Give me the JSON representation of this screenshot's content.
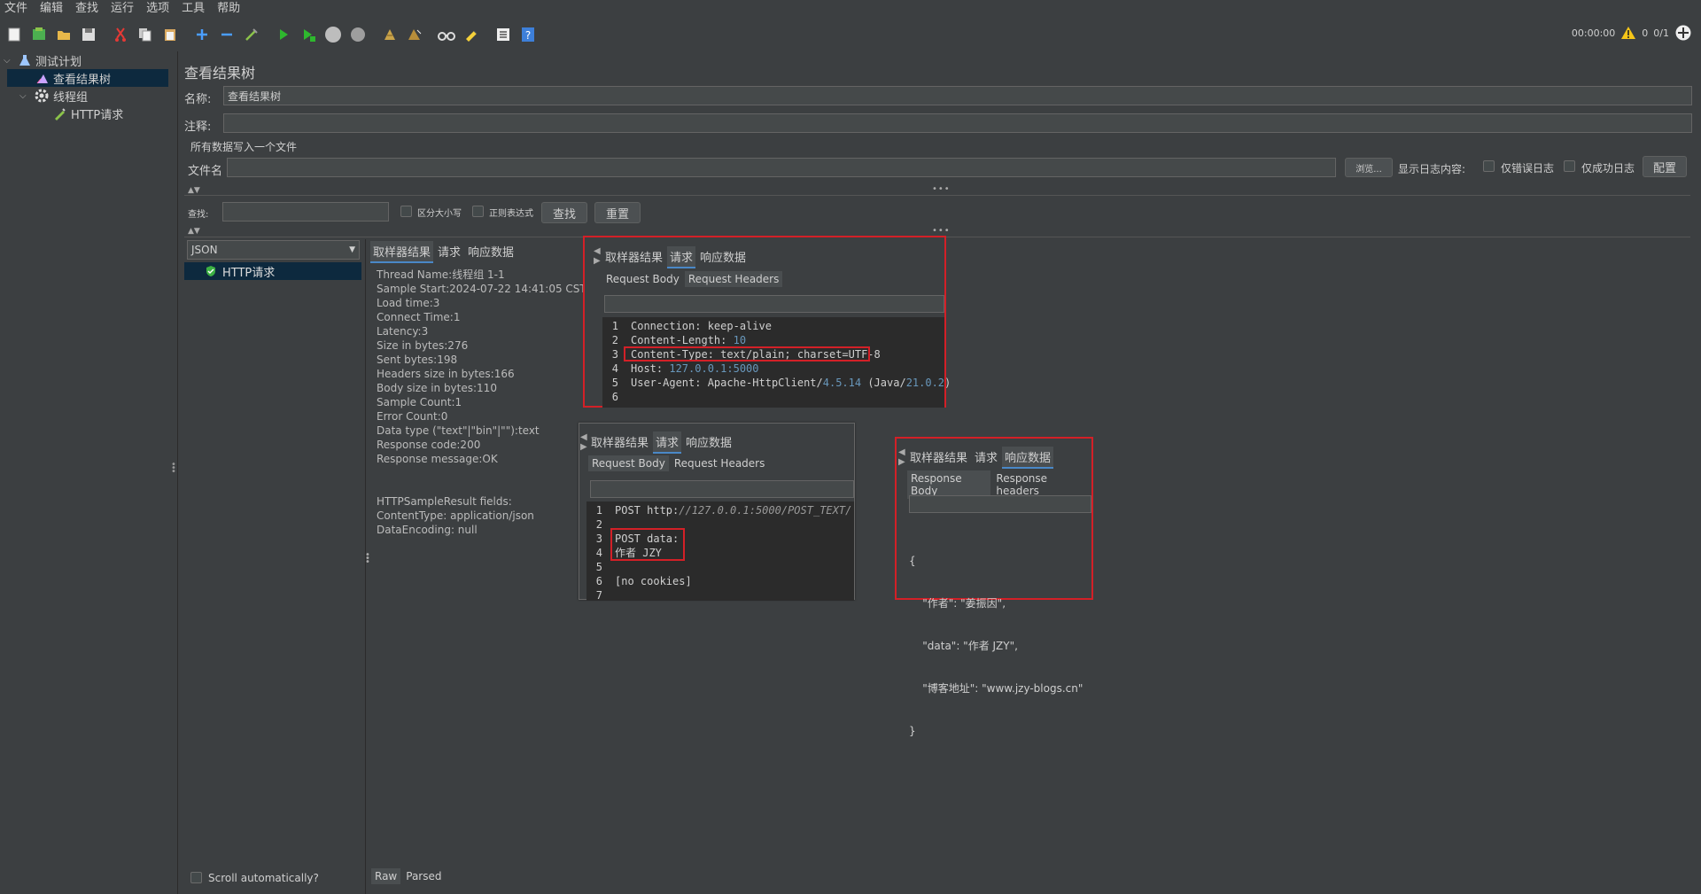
{
  "menu": [
    "文件",
    "编辑",
    "查找",
    "运行",
    "选项",
    "工具",
    "帮助"
  ],
  "toolbar": {
    "icons": [
      "new-icon",
      "templates-icon",
      "open-icon",
      "save-icon",
      "save-as-icon",
      "cut-icon",
      "copy-icon",
      "paste-icon",
      "expand-icon",
      "collapse-icon",
      "toggle-icon",
      "start-icon",
      "start-no-pause-icon",
      "stop-icon",
      "shutdown-icon",
      "clear-icon",
      "clear-all-icon",
      "search-icon",
      "reset-search-icon",
      "function-helper-icon",
      "help-icon"
    ],
    "timer": "00:00:00",
    "warnings": "0",
    "threads": "0/1"
  },
  "tree": {
    "items": [
      {
        "label": "测试计划",
        "icon": "test-plan-icon"
      },
      {
        "label": "查看结果树",
        "icon": "listener-icon"
      },
      {
        "label": "线程组",
        "icon": "gear-icon"
      },
      {
        "label": "HTTP请求",
        "icon": "sampler-icon"
      }
    ]
  },
  "main": {
    "title": "查看结果树",
    "name_label": "名称:",
    "name_value": "查看结果树",
    "comment_label": "注释:",
    "comment_value": "",
    "file_section": "所有数据写入一个文件",
    "filename_label": "文件名",
    "filename_value": "",
    "browse_button": "浏览...",
    "log_display_label": "显示日志内容:",
    "errors_only": "仅错误日志",
    "success_only": "仅成功日志",
    "config_button": "配置",
    "search_label": "查找:",
    "search_value": "",
    "case_sensitive": "区分大小写",
    "regex": "正则表达式",
    "find_button": "查找",
    "reset_button": "重置"
  },
  "results": {
    "renderer": "JSON",
    "list_items": [
      "HTTP请求"
    ],
    "scroll_auto": "Scroll automatically?",
    "tabs": [
      "取样器结果",
      "请求",
      "响应数据"
    ],
    "sampler_lines": [
      "Thread Name:线程组 1-1",
      "Sample Start:2024-07-22 14:41:05 CST",
      "Load time:3",
      "Connect Time:1",
      "Latency:3",
      "Size in bytes:276",
      "Sent bytes:198",
      "Headers size in bytes:166",
      "Body size in bytes:110",
      "Sample Count:1",
      "Error Count:0",
      "Data type (\"text\"|\"bin\"|\"\"):text",
      "Response code:200",
      "Response message:OK",
      "",
      "",
      "HTTPSampleResult fields:",
      "ContentType: application/json",
      "DataEncoding: null"
    ],
    "bottom_tabs": [
      "Raw",
      "Parsed"
    ]
  },
  "popup_headers": {
    "tabs": [
      "取样器结果",
      "请求",
      "响应数据"
    ],
    "subtabs": [
      "Request Body",
      "Request Headers"
    ],
    "lines": [
      {
        "n": "1",
        "text": "Connection: keep-alive"
      },
      {
        "n": "2",
        "pre": "Content-Length: ",
        "num": "10"
      },
      {
        "n": "3",
        "text": "Content-Type: text/plain; charset=UTF-8"
      },
      {
        "n": "4",
        "pre": "Host: ",
        "num": "127.0.0.1:5000"
      },
      {
        "n": "5",
        "pre": "User-Agent: Apache-HttpClient/",
        "num": "4.5.14",
        "mid": " (Java/",
        "num2": "21.0.2",
        ")": ")"
      },
      {
        "n": "6",
        "text": ""
      }
    ]
  },
  "popup_body": {
    "tabs": [
      "取样器结果",
      "请求",
      "响应数据"
    ],
    "subtabs": [
      "Request Body",
      "Request Headers"
    ],
    "lines": [
      {
        "n": "1",
        "pre": "POST http:",
        "ital": "//127.0.0.1:5000/POST_TEXT/"
      },
      {
        "n": "2",
        "text": ""
      },
      {
        "n": "3",
        "text": "POST data:"
      },
      {
        "n": "4",
        "text": "作者 JZY"
      },
      {
        "n": "5",
        "text": ""
      },
      {
        "n": "6",
        "text": "[no cookies]"
      },
      {
        "n": "7",
        "text": ""
      }
    ]
  },
  "popup_response": {
    "tabs": [
      "取样器结果",
      "请求",
      "响应数据"
    ],
    "subtabs": [
      "Response Body",
      "Response headers"
    ],
    "lines": [
      "{",
      "    \"作者\": \"姜振因\",",
      "    \"data\": \"作者 JZY\",",
      "    \"博客地址\": \"www.jzy-blogs.cn\"",
      "}"
    ]
  },
  "colors": {
    "accent": "#4a88c7",
    "highlight": "#d32027",
    "selection": "#0d293e",
    "background": "#3c3f41"
  }
}
